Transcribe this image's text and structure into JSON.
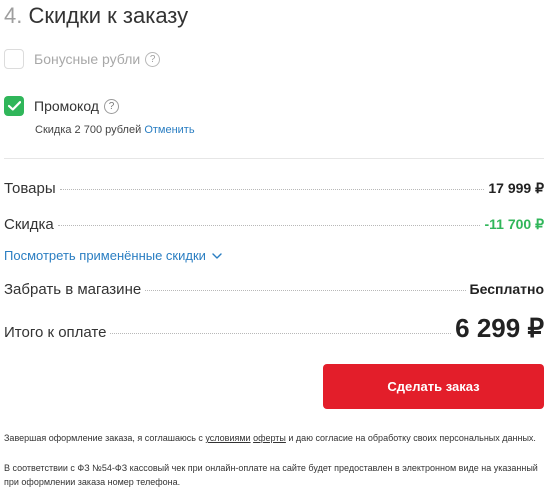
{
  "section": {
    "number": "4.",
    "title": "Скидки к заказу"
  },
  "bonus": {
    "label": "Бонусные рубли",
    "help": "?",
    "checked": false
  },
  "promo": {
    "label": "Промокод",
    "help": "?",
    "checked": true,
    "note": "Скидка 2 700 рублей",
    "cancel_link": "Отменить"
  },
  "summary": {
    "goods_label": "Товары",
    "goods_value": "17 999 ₽",
    "discount_label": "Скидка",
    "discount_value": "-11 700 ₽",
    "view_discounts_link": "Посмотреть применённые скидки",
    "pickup_label": "Забрать в магазине",
    "pickup_value": "Бесплатно",
    "total_label": "Итого к оплате",
    "total_value": "6 299 ₽"
  },
  "order_button": "Сделать заказ",
  "legal": {
    "p1_before": "Завершая оформление заказа, я соглашаюсь с ",
    "p1_link1": "условиями",
    "p1_space": " ",
    "p1_link2": "оферты",
    "p1_after": " и даю согласие на обработку своих персональных данных.",
    "p2": "В соответствии с ФЗ №54-ФЗ кассовый чек при онлайн-оплате на сайте будет предоставлен в электронном виде на указанный при оформлении заказа номер телефона."
  },
  "colors": {
    "accent_red": "#e31e2a",
    "success_green": "#30b65a",
    "link_blue": "#2a7ec2"
  }
}
